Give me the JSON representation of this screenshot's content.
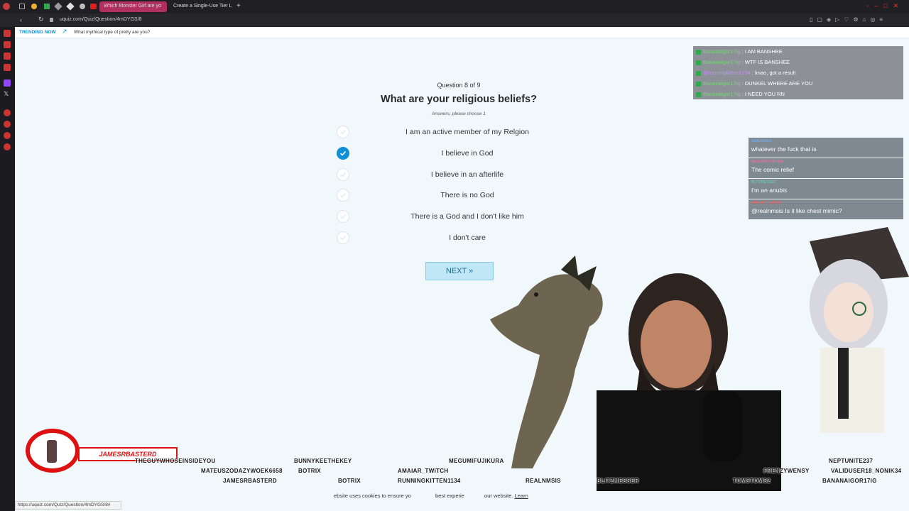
{
  "browser": {
    "tabs": [
      {
        "label": "Which Monster Girl are yo"
      },
      {
        "label": "Create a Single-Use Tier L"
      }
    ],
    "url": "uquiz.com/Quiz/Question/4mDYGS/8",
    "status_url": "https://uquiz.com/Quiz/Question/4mDYGS/8#"
  },
  "trending": {
    "label": "TRENDING NOW",
    "link": "What mythical type of pretty are you?"
  },
  "quiz": {
    "progress": "Question 8 of 9",
    "question": "What are your religious beliefs?",
    "hint": "Answers, please choose 1",
    "options": [
      {
        "label": "I am an active member of my Relgion",
        "selected": false
      },
      {
        "label": "I believe in God",
        "selected": true
      },
      {
        "label": "I believe in an afterlife",
        "selected": false
      },
      {
        "label": "There is no God",
        "selected": false
      },
      {
        "label": "There is a God and I don't like him",
        "selected": false
      },
      {
        "label": "I don't care",
        "selected": false
      }
    ],
    "next_label": "NEXT »"
  },
  "chat_top": [
    {
      "user": "Bananalgor17ig",
      "msg": "I AM BANSHEE",
      "color": "#7fd07f"
    },
    {
      "user": "Bananalgor17ig",
      "msg": "WTF IS BANSHEE",
      "color": "#7fd07f"
    },
    {
      "user": "@runningkitten1134",
      "msg": "lmao, got a result",
      "color": "#c58cff"
    },
    {
      "user": "Bananalgor17ig",
      "msg": "DUNKEL WHERE ARE YOU",
      "color": "#7fd07f"
    },
    {
      "user": "Bananalgor17ig",
      "msg": "I NEED YOU RN",
      "color": "#7fd07f"
    }
  ],
  "chat_side": [
    {
      "user": "REALNMSIS",
      "msg": "whatever the fuck that is",
      "color": "#6fb6ff"
    },
    {
      "user": "MEGUMIFUJIKURA",
      "msg": "The comic relief",
      "color": "#ff6fa0"
    },
    {
      "user": "BLITZMESSER",
      "msg": "I'm an anubis",
      "color": "#6fd0c0"
    },
    {
      "user": "AMAIAR_TWITCH",
      "msg": "@realnmsis Is it like chest mimic?",
      "color": "#ff5a5a"
    }
  ],
  "stream": {
    "alert_name": "JAMESRBASTERD",
    "aliases": [
      "THEGUYWHOSEINSIDEYOU",
      "MATEUSZODAZYWOEK6658",
      "BOTRIX",
      "JAMESRBASTERD",
      "BUNNYKEETHEKEY",
      "BOTRIX",
      "AMAIAR_TWITCH",
      "RUNNINGKITTEN1134",
      "MEGUMIFUJIKURA",
      "REALNMSIS",
      "BLITZMESSER",
      "TOMSTOMS2",
      "FRENZYWENSY",
      "NEPTUNITE237",
      "VALIDUSER18_NONIK34",
      "BANANAIGOR17IG"
    ],
    "cookie_text": "ebsite uses cookies to ensure yo",
    "cookie_text2": "best experie",
    "cookie_text3": "our website.",
    "cookie_learn": "Learn"
  }
}
